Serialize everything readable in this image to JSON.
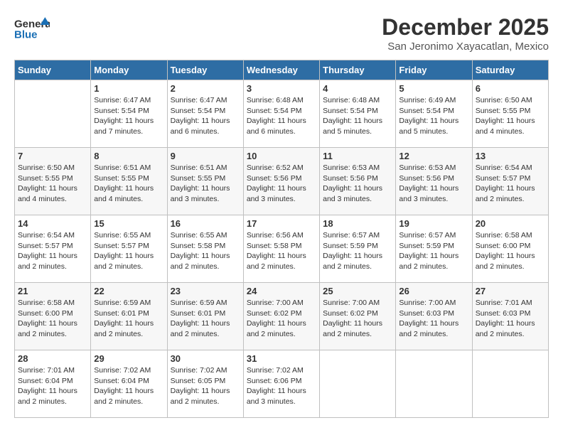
{
  "header": {
    "logo_general": "General",
    "logo_blue": "Blue",
    "title": "December 2025",
    "subtitle": "San Jeronimo Xayacatlan, Mexico"
  },
  "days_of_week": [
    "Sunday",
    "Monday",
    "Tuesday",
    "Wednesday",
    "Thursday",
    "Friday",
    "Saturday"
  ],
  "weeks": [
    [
      {
        "day": "",
        "info": ""
      },
      {
        "day": "1",
        "info": "Sunrise: 6:47 AM\nSunset: 5:54 PM\nDaylight: 11 hours\nand 7 minutes."
      },
      {
        "day": "2",
        "info": "Sunrise: 6:47 AM\nSunset: 5:54 PM\nDaylight: 11 hours\nand 6 minutes."
      },
      {
        "day": "3",
        "info": "Sunrise: 6:48 AM\nSunset: 5:54 PM\nDaylight: 11 hours\nand 6 minutes."
      },
      {
        "day": "4",
        "info": "Sunrise: 6:48 AM\nSunset: 5:54 PM\nDaylight: 11 hours\nand 5 minutes."
      },
      {
        "day": "5",
        "info": "Sunrise: 6:49 AM\nSunset: 5:54 PM\nDaylight: 11 hours\nand 5 minutes."
      },
      {
        "day": "6",
        "info": "Sunrise: 6:50 AM\nSunset: 5:55 PM\nDaylight: 11 hours\nand 4 minutes."
      }
    ],
    [
      {
        "day": "7",
        "info": "Sunrise: 6:50 AM\nSunset: 5:55 PM\nDaylight: 11 hours\nand 4 minutes."
      },
      {
        "day": "8",
        "info": "Sunrise: 6:51 AM\nSunset: 5:55 PM\nDaylight: 11 hours\nand 4 minutes."
      },
      {
        "day": "9",
        "info": "Sunrise: 6:51 AM\nSunset: 5:55 PM\nDaylight: 11 hours\nand 3 minutes."
      },
      {
        "day": "10",
        "info": "Sunrise: 6:52 AM\nSunset: 5:56 PM\nDaylight: 11 hours\nand 3 minutes."
      },
      {
        "day": "11",
        "info": "Sunrise: 6:53 AM\nSunset: 5:56 PM\nDaylight: 11 hours\nand 3 minutes."
      },
      {
        "day": "12",
        "info": "Sunrise: 6:53 AM\nSunset: 5:56 PM\nDaylight: 11 hours\nand 3 minutes."
      },
      {
        "day": "13",
        "info": "Sunrise: 6:54 AM\nSunset: 5:57 PM\nDaylight: 11 hours\nand 2 minutes."
      }
    ],
    [
      {
        "day": "14",
        "info": "Sunrise: 6:54 AM\nSunset: 5:57 PM\nDaylight: 11 hours\nand 2 minutes."
      },
      {
        "day": "15",
        "info": "Sunrise: 6:55 AM\nSunset: 5:57 PM\nDaylight: 11 hours\nand 2 minutes."
      },
      {
        "day": "16",
        "info": "Sunrise: 6:55 AM\nSunset: 5:58 PM\nDaylight: 11 hours\nand 2 minutes."
      },
      {
        "day": "17",
        "info": "Sunrise: 6:56 AM\nSunset: 5:58 PM\nDaylight: 11 hours\nand 2 minutes."
      },
      {
        "day": "18",
        "info": "Sunrise: 6:57 AM\nSunset: 5:59 PM\nDaylight: 11 hours\nand 2 minutes."
      },
      {
        "day": "19",
        "info": "Sunrise: 6:57 AM\nSunset: 5:59 PM\nDaylight: 11 hours\nand 2 minutes."
      },
      {
        "day": "20",
        "info": "Sunrise: 6:58 AM\nSunset: 6:00 PM\nDaylight: 11 hours\nand 2 minutes."
      }
    ],
    [
      {
        "day": "21",
        "info": "Sunrise: 6:58 AM\nSunset: 6:00 PM\nDaylight: 11 hours\nand 2 minutes."
      },
      {
        "day": "22",
        "info": "Sunrise: 6:59 AM\nSunset: 6:01 PM\nDaylight: 11 hours\nand 2 minutes."
      },
      {
        "day": "23",
        "info": "Sunrise: 6:59 AM\nSunset: 6:01 PM\nDaylight: 11 hours\nand 2 minutes."
      },
      {
        "day": "24",
        "info": "Sunrise: 7:00 AM\nSunset: 6:02 PM\nDaylight: 11 hours\nand 2 minutes."
      },
      {
        "day": "25",
        "info": "Sunrise: 7:00 AM\nSunset: 6:02 PM\nDaylight: 11 hours\nand 2 minutes."
      },
      {
        "day": "26",
        "info": "Sunrise: 7:00 AM\nSunset: 6:03 PM\nDaylight: 11 hours\nand 2 minutes."
      },
      {
        "day": "27",
        "info": "Sunrise: 7:01 AM\nSunset: 6:03 PM\nDaylight: 11 hours\nand 2 minutes."
      }
    ],
    [
      {
        "day": "28",
        "info": "Sunrise: 7:01 AM\nSunset: 6:04 PM\nDaylight: 11 hours\nand 2 minutes."
      },
      {
        "day": "29",
        "info": "Sunrise: 7:02 AM\nSunset: 6:04 PM\nDaylight: 11 hours\nand 2 minutes."
      },
      {
        "day": "30",
        "info": "Sunrise: 7:02 AM\nSunset: 6:05 PM\nDaylight: 11 hours\nand 2 minutes."
      },
      {
        "day": "31",
        "info": "Sunrise: 7:02 AM\nSunset: 6:06 PM\nDaylight: 11 hours\nand 3 minutes."
      },
      {
        "day": "",
        "info": ""
      },
      {
        "day": "",
        "info": ""
      },
      {
        "day": "",
        "info": ""
      }
    ]
  ]
}
